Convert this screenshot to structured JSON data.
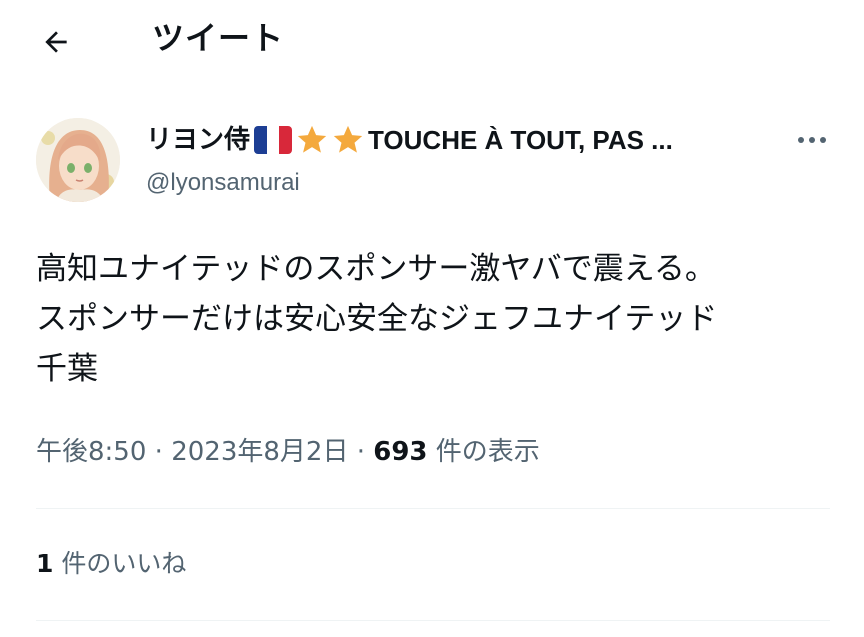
{
  "header": {
    "title": "ツイート",
    "back_icon": "arrow-left-icon"
  },
  "author": {
    "name": "リヨン侍",
    "name_tag": "TOUCHE À TOUT, PAS ...",
    "handle": "@lyonsamurai",
    "emoji_flag": "french-flag-icon",
    "emoji_star": "star-icon"
  },
  "tweet": {
    "lines": [
      "高知ユナイテッドのスポンサー激ヤバで震える。",
      "スポンサーだけは安心安全なジェフユナイテッド",
      "千葉"
    ]
  },
  "meta": {
    "time": "午後8:50",
    "separator": " · ",
    "date": "2023年8月2日",
    "views_count": "693",
    "views_label": " 件の表示"
  },
  "likes": {
    "count": "1",
    "label": " 件のいいね"
  },
  "colors": {
    "text": "#0f1419",
    "secondary": "#536471",
    "divider": "#eff3f4",
    "star": "#f4a93d",
    "flag_blue": "#1d3e94",
    "flag_red": "#d8283a"
  }
}
